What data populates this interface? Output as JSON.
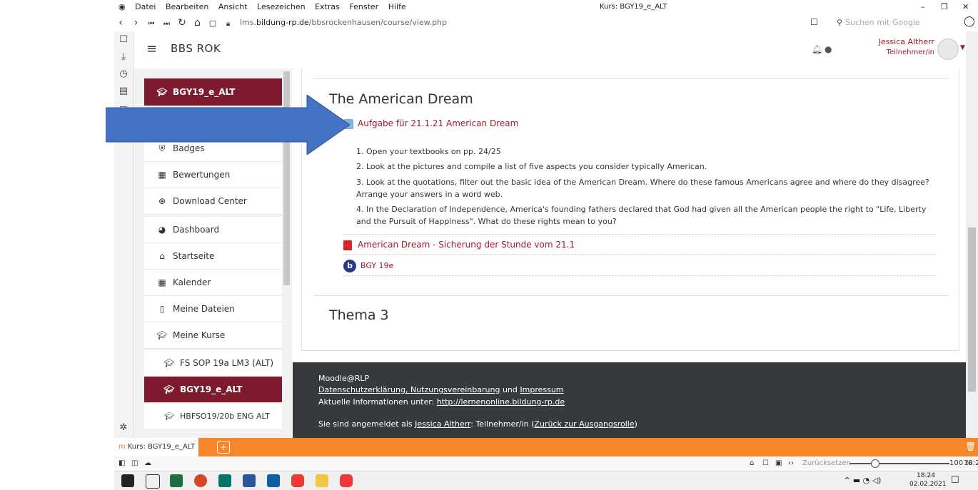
{
  "browser": {
    "menu": [
      "Datei",
      "Bearbeiten",
      "Ansicht",
      "Lesezeichen",
      "Extras",
      "Fenster",
      "Hilfe"
    ],
    "window_title": "Kurs: BGY19_e_ALT",
    "url_prefix": "lms.",
    "url_domain": "bildung-rp.de",
    "url_path": "/bbsrockenhausen/course/view.php",
    "search_placeholder": "Suchen mit Google"
  },
  "header": {
    "site_name": "BBS ROK",
    "user_name": "Jessica Altherr",
    "user_role": "Teilnehmer/in"
  },
  "drawer": {
    "top_course": "BGY19_e_ALT",
    "items": [
      {
        "icon": "shield-icon",
        "label": "Badges"
      },
      {
        "icon": "table-icon",
        "label": "Bewertungen"
      },
      {
        "icon": "download-icon",
        "label": "Download Center"
      },
      {
        "icon": "dashboard-icon",
        "label": "Dashboard"
      },
      {
        "icon": "home-icon",
        "label": "Startseite"
      },
      {
        "icon": "calendar-icon",
        "label": "Kalender"
      },
      {
        "icon": "file-icon",
        "label": "Meine Dateien"
      },
      {
        "icon": "graduation-cap-icon",
        "label": "Meine Kurse"
      },
      {
        "icon": "graduation-cap-icon",
        "label": "FS SOP 19a LM3 (ALT)"
      },
      {
        "icon": "graduation-cap-icon",
        "label": "BGY19_e_ALT"
      },
      {
        "icon": "graduation-cap-icon",
        "label": "HBFSO19/20b ENG ALT"
      }
    ]
  },
  "main": {
    "section_title": "The American Dream",
    "assignment_link": "Aufgabe für 21.1.21 American Dream",
    "steps": [
      "1. Open your textbooks on pp. 24/25",
      "2. Look at the pictures and compile a list of five aspects you consider typically American.",
      "3. Look at the quotations, filter out the basic idea of the American Dream. Where do these famous Americans agree and where do they disagree? Arrange your answers in a word web.",
      "4. In the Declaration of Independence, America's founding fathers declared that God had given all the American people the right to \"Life, Liberty and the Pursuit of Happiness\". What do these rights mean to you?"
    ],
    "pdf_link": "American Dream - Sicherung der Stunde vom 21.1",
    "bbb_link": "BGY 19e",
    "next_section": "Thema 3"
  },
  "footer": {
    "line1": "Moodle@RLP",
    "privacy": "Datenschutzerklärung, Nutzungsvereinbarung",
    "and": " und ",
    "imprint": "Impressum",
    "news_prefix": "Aktuelle Informationen unter: ",
    "news_link": "http://lernenonline.bildung-rp.de",
    "logged_prefix": "Sie sind angemeldet als ",
    "logged_user": "Jessica Altherr",
    "logged_role": ": Teilnehmer/in (",
    "return_role": "Zurück zur Ausgangsrolle",
    "close_paren": ")"
  },
  "tabs": {
    "active": "Kurs: BGY19_e_ALT"
  },
  "statusbar": {
    "reset": "Zurücksetzen",
    "zoom": "100 %",
    "time": "18:24"
  },
  "taskbar": {
    "time": "18:24",
    "date": "02.02.2021"
  },
  "colors": {
    "accent": "#7d1a2e",
    "link": "#a01830",
    "arrow": "#4472c4",
    "tabbar": "#f5862a",
    "footer": "#373a3c"
  }
}
